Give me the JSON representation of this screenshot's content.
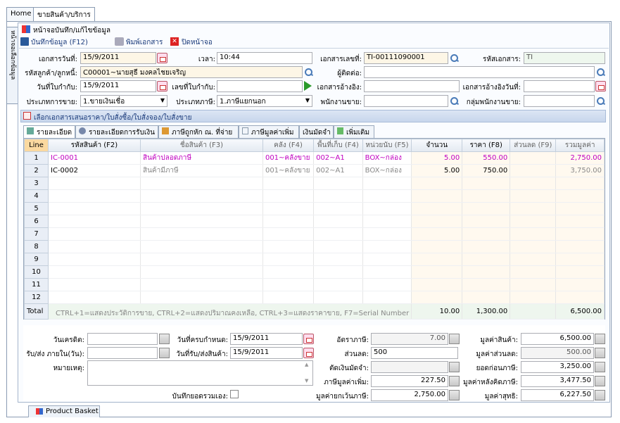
{
  "tabs": {
    "home": "Home",
    "sales": "ขายสินค้า/บริการ"
  },
  "sidebar_vertical": "หน้าจอเลือกข้อมูล",
  "form_header": {
    "title": "หน้าจอบันทึก/แก้ไขข้อมูล",
    "save": "บันทึกข้อมูล (F12)",
    "print": "พิมพ์เอกสาร",
    "close": "ปิดหน้าจอ"
  },
  "fields": {
    "doc_date_label": "เอกสารวันที่:",
    "doc_date": "15/9/2011",
    "time_label": "เวลา:",
    "time": "10:44",
    "doc_no_label": "เอกสารเลขที่:",
    "doc_no": "TI-00111090001",
    "doc_code_label": "รหัสเอกสาร:",
    "doc_code": "TI",
    "customer_label": "รหัสลูกค้า/ลูกหนี้:",
    "customer": "C00001~นายสุธี มงคลไชยเจริญ",
    "contact_label": "ผู้ติดต่อ:",
    "contact": "",
    "tax_inv_date_label": "วันที่ใบกำกับ:",
    "tax_inv_date": "15/9/2011",
    "tax_inv_no_label": "เลขที่ใบกำกับ:",
    "tax_inv_no": "",
    "ref_doc_label": "เอกสารอ้างอิง:",
    "ref_doc": "",
    "ref_doc_date_label": "เอกสารอ้างอิงวันที่:",
    "ref_doc_date": "",
    "sale_type_label": "ประเภทการขาย:",
    "sale_type": "1.ขายเงินเชื่อ",
    "tax_type_label": "ประเภทภาษี:",
    "tax_type": "1.ภาษีแยกนอก",
    "salesperson_label": "พนักงานขาย:",
    "salesperson": "",
    "sales_group_label": "กลุ่มพนักงานขาย:",
    "sales_group": ""
  },
  "select_doc_bar": "เลือกเอกสารเสนอราคา/ใบสั่งซื้อ/ใบสั่งจอง/ใบสั่งขาย",
  "detail_tabs": [
    "รายละเอียด",
    "รายละเอียดการรับเงิน",
    "ภาษีถูกหัก ณ. ที่จ่าย",
    "ภาษีมูลค่าเพิ่ม",
    "เงินมัดจำ",
    "เพิ่มเติม"
  ],
  "grid": {
    "headers": [
      "Line",
      "รหัสสินค้า (F2)",
      "ชื่อสินค้า (F3)",
      "คลัง (F4)",
      "พื้นที่เก็บ (F4)",
      "หน่วยนับ (F5)",
      "จำนวน",
      "ราคา (F8)",
      "ส่วนลด (F9)",
      "รวมมูลค่า"
    ],
    "rows": [
      {
        "line": "1",
        "code": "IC-0001",
        "name": "สินค้าปลอดภาษี",
        "wh": "001~คลังขาย",
        "loc": "002~A1",
        "unit": "BOX~กล่อง",
        "qty": "5.00",
        "price": "550.00",
        "disc": "",
        "total": "2,750.00"
      },
      {
        "line": "2",
        "code": "IC-0002",
        "name": "สินค้ามีภาษี",
        "wh": "001~คลังขาย",
        "loc": "002~A1",
        "unit": "BOX~กล่อง",
        "qty": "5.00",
        "price": "750.00",
        "disc": "",
        "total": "3,750.00"
      }
    ],
    "empty_lines": [
      "3",
      "4",
      "5",
      "6",
      "7",
      "8",
      "9",
      "10",
      "11",
      "12"
    ],
    "total_label": "Total",
    "hint": "CTRL+1=แสดงประวัติการขาย, CTRL+2=แสดงปริมาณคงเหลือ, CTRL+3=แสดงราคาขาย, F7=Serial Number",
    "total_qty": "10.00",
    "total_price": "1,300.00",
    "total_amount": "6,500.00"
  },
  "bottom": {
    "credit_days_label": "วันเครดิต:",
    "credit_days": "",
    "due_date_label": "วันที่ครบกำหนด:",
    "due_date": "15/9/2011",
    "vat_rate_label": "อัตราภาษี:",
    "vat_rate": "7.00",
    "goods_value_label": "มูลค่าสินค้า:",
    "goods_value": "6,500.00",
    "deliver_days_label": "รับ/ส่ง ภายใน(วัน):",
    "deliver_days": "",
    "deliver_date_label": "วันที่รับ/ส่งสินค้า:",
    "deliver_date": "15/9/2011",
    "discount_label": "ส่วนลด:",
    "discount": "500",
    "discount_value_label": "มูลค่าส่วนลด:",
    "discount_value": "500.00",
    "remark_label": "หมายเหตุ:",
    "remark": "",
    "deposit_label": "ตัดเงินมัดจำ:",
    "deposit": "",
    "before_tax_label": "ยอดก่อนภาษี:",
    "before_tax": "3,250.00",
    "vat_label": "ภาษีมูลค่าเพิ่ม:",
    "vat": "227.50",
    "after_tax_label": "มูลค่าหลังคิดภาษี:",
    "after_tax": "3,477.50",
    "manual_total_label": "บันทึกยอดรวมเอง:",
    "exempt_label": "มูลค่ายกเว้นภาษี:",
    "exempt": "2,750.00",
    "net_label": "มูลค่าสุทธิ:",
    "net": "6,227.50"
  },
  "basket": "Product Basket"
}
